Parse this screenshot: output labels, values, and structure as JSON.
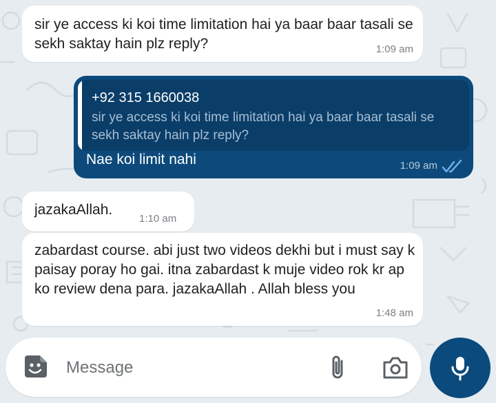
{
  "colors": {
    "background": "#e6ecf0",
    "incoming_bubble": "#ffffff",
    "outgoing_bubble": "#0d4a7b",
    "quote_background": "#0a3e69",
    "read_ticks": "#6fb4f0",
    "mic_button": "#0b4a7c"
  },
  "messages": [
    {
      "direction": "incoming",
      "text": "sir ye access ki koi time limitation hai ya baar baar tasali se sekh saktay hain plz reply?",
      "time": "1:09 am"
    },
    {
      "direction": "outgoing",
      "quoted_author": "+92 315 1660038",
      "quoted_text": "sir ye access ki koi time limitation hai ya baar baar tasali se sekh saktay hain plz reply?",
      "text": "Nae koi limit nahi",
      "time": "1:09 am",
      "status_icon": "double-check-read-icon"
    },
    {
      "direction": "incoming",
      "text": "jazakaAllah.",
      "time": "1:10 am"
    },
    {
      "direction": "incoming",
      "text": "zabardast course. abi just two videos dekhi but i must say k paisay poray ho gai. itna zabardast k muje video rok kr ap ko review dena para. jazakaAllah . Allah bless you",
      "time": "1:48 am"
    }
  ],
  "composer": {
    "placeholder": "Message",
    "value": "",
    "emoji_icon": "sticker-smiley-icon",
    "attach_icon": "paperclip-icon",
    "camera_icon": "camera-icon",
    "mic_icon": "microphone-icon"
  }
}
